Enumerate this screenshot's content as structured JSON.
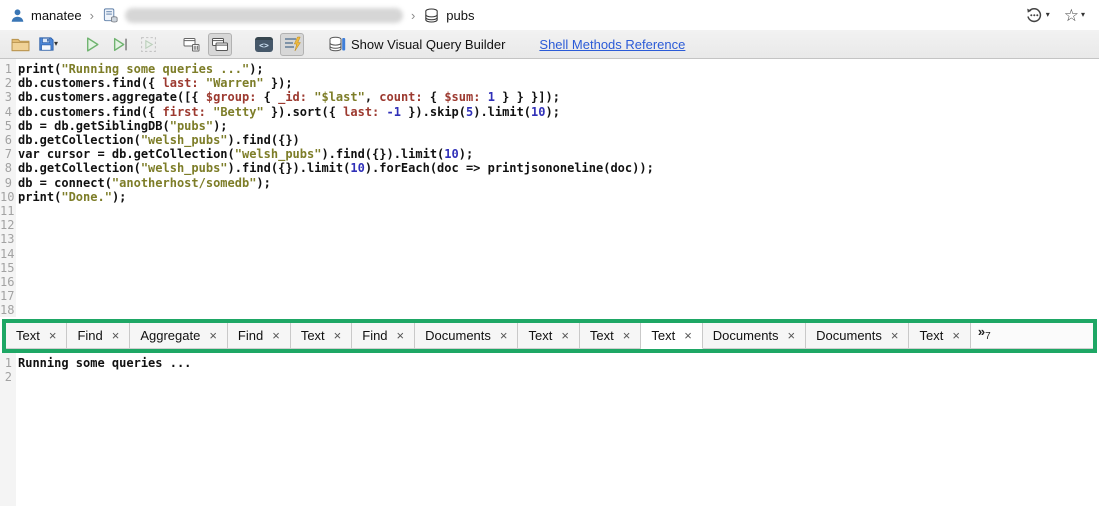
{
  "colors": {
    "green": "#1ea765",
    "string": "#7d7d28",
    "field": "#9c392f",
    "number": "#3030b8",
    "link": "#2b5bd7"
  },
  "breadcrumb": {
    "user": "manatee",
    "chevron": "›",
    "collection": "pubs"
  },
  "toolbar": {
    "vqb_label": "Show Visual Query Builder",
    "reference_link": "Shell Methods Reference",
    "save_caret": "▾",
    "code_glyph": "<>"
  },
  "topbar_icons": {
    "history_caret": "▾",
    "star_glyph": "☆",
    "star_caret": "▾"
  },
  "editor": {
    "lines": [
      {
        "n": 1,
        "seg": [
          [
            "d",
            "print("
          ],
          [
            "s",
            "\"Running some queries ...\""
          ],
          [
            "d",
            ");"
          ]
        ]
      },
      {
        "n": 2,
        "seg": [
          [
            "d",
            "db.customers.find({ "
          ],
          [
            "f",
            "last:"
          ],
          [
            "d",
            " "
          ],
          [
            "s",
            "\"Warren\""
          ],
          [
            "d",
            " });"
          ]
        ]
      },
      {
        "n": 3,
        "seg": [
          [
            "d",
            "db.customers.aggregate([{ "
          ],
          [
            "f",
            "$group:"
          ],
          [
            "d",
            " { "
          ],
          [
            "f",
            "_id:"
          ],
          [
            "d",
            " "
          ],
          [
            "s",
            "\"$last\""
          ],
          [
            "d",
            ", "
          ],
          [
            "f",
            "count:"
          ],
          [
            "d",
            " { "
          ],
          [
            "f",
            "$sum:"
          ],
          [
            "d",
            " "
          ],
          [
            "n",
            "1"
          ],
          [
            "d",
            " } } }]);"
          ]
        ]
      },
      {
        "n": 4,
        "seg": [
          [
            "d",
            "db.customers.find({ "
          ],
          [
            "f",
            "first:"
          ],
          [
            "d",
            " "
          ],
          [
            "s",
            "\"Betty\""
          ],
          [
            "d",
            " }).sort({ "
          ],
          [
            "f",
            "last:"
          ],
          [
            "d",
            " "
          ],
          [
            "n",
            "-1"
          ],
          [
            "d",
            " }).skip("
          ],
          [
            "n",
            "5"
          ],
          [
            "d",
            ").limit("
          ],
          [
            "n",
            "10"
          ],
          [
            "d",
            ");"
          ]
        ]
      },
      {
        "n": 5,
        "seg": [
          [
            "d",
            "db = db.getSiblingDB("
          ],
          [
            "s",
            "\"pubs\""
          ],
          [
            "d",
            ");"
          ]
        ]
      },
      {
        "n": 6,
        "seg": [
          [
            "d",
            "db.getCollection("
          ],
          [
            "s",
            "\"welsh_pubs\""
          ],
          [
            "d",
            ").find({})"
          ]
        ]
      },
      {
        "n": 7,
        "seg": [
          [
            "d",
            "var cursor = db.getCollection("
          ],
          [
            "s",
            "\"welsh_pubs\""
          ],
          [
            "d",
            ").find({}).limit("
          ],
          [
            "n",
            "10"
          ],
          [
            "d",
            ");"
          ]
        ]
      },
      {
        "n": 8,
        "seg": [
          [
            "d",
            "db.getCollection("
          ],
          [
            "s",
            "\"welsh_pubs\""
          ],
          [
            "d",
            ").find({}).limit("
          ],
          [
            "n",
            "10"
          ],
          [
            "d",
            ").forEach(doc => printjsononeline(doc));"
          ]
        ]
      },
      {
        "n": 9,
        "seg": [
          [
            "d",
            "db = connect("
          ],
          [
            "s",
            "\"anotherhost/somedb\""
          ],
          [
            "d",
            ");"
          ]
        ]
      },
      {
        "n": 10,
        "seg": [
          [
            "d",
            "print("
          ],
          [
            "s",
            "\"Done.\""
          ],
          [
            "d",
            ");"
          ]
        ]
      },
      {
        "n": 11,
        "seg": []
      },
      {
        "n": 12,
        "seg": []
      },
      {
        "n": 13,
        "seg": []
      },
      {
        "n": 14,
        "seg": []
      },
      {
        "n": 15,
        "seg": []
      },
      {
        "n": 16,
        "seg": []
      },
      {
        "n": 17,
        "seg": []
      },
      {
        "n": 18,
        "seg": []
      }
    ]
  },
  "tabs": {
    "close_glyph": "×",
    "overflow_chevron": "»",
    "overflow_count": "7",
    "items": [
      {
        "label": "Text",
        "selected": false
      },
      {
        "label": "Find",
        "selected": false
      },
      {
        "label": "Aggregate",
        "selected": false
      },
      {
        "label": "Find",
        "selected": false
      },
      {
        "label": "Text",
        "selected": false
      },
      {
        "label": "Find",
        "selected": false
      },
      {
        "label": "Documents",
        "selected": false
      },
      {
        "label": "Text",
        "selected": false
      },
      {
        "label": "Text",
        "selected": false
      },
      {
        "label": "Text",
        "selected": true
      },
      {
        "label": "Documents",
        "selected": false
      },
      {
        "label": "Documents",
        "selected": false
      },
      {
        "label": "Text",
        "selected": false
      }
    ]
  },
  "results": {
    "lines": [
      {
        "n": 1,
        "text": "Running some queries ..."
      },
      {
        "n": 2,
        "text": ""
      }
    ]
  }
}
